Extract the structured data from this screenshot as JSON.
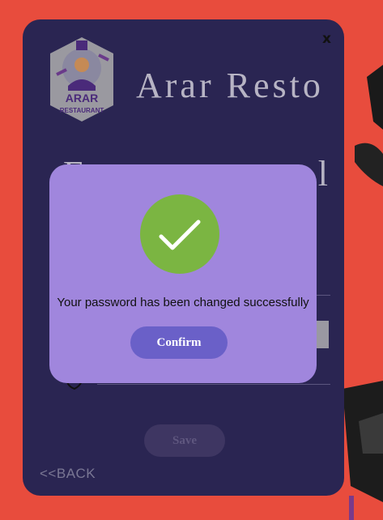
{
  "window": {
    "close_label": "x",
    "brand_title": "Arar Resto",
    "page_heading_left": "F",
    "page_heading_right": "l",
    "logo": {
      "line1": "ARAR",
      "line2": "RESTAURANT"
    },
    "save_label": "Save",
    "back_label": "<<BACK"
  },
  "modal": {
    "message": "Your password has been changed successfully",
    "confirm_label": "Confirm",
    "icon": "checkmark-icon"
  },
  "colors": {
    "background": "#e84c3d",
    "window": "#2a2552",
    "modal": "#a086dd",
    "check": "#7bb542",
    "confirm": "#6a60c8"
  }
}
